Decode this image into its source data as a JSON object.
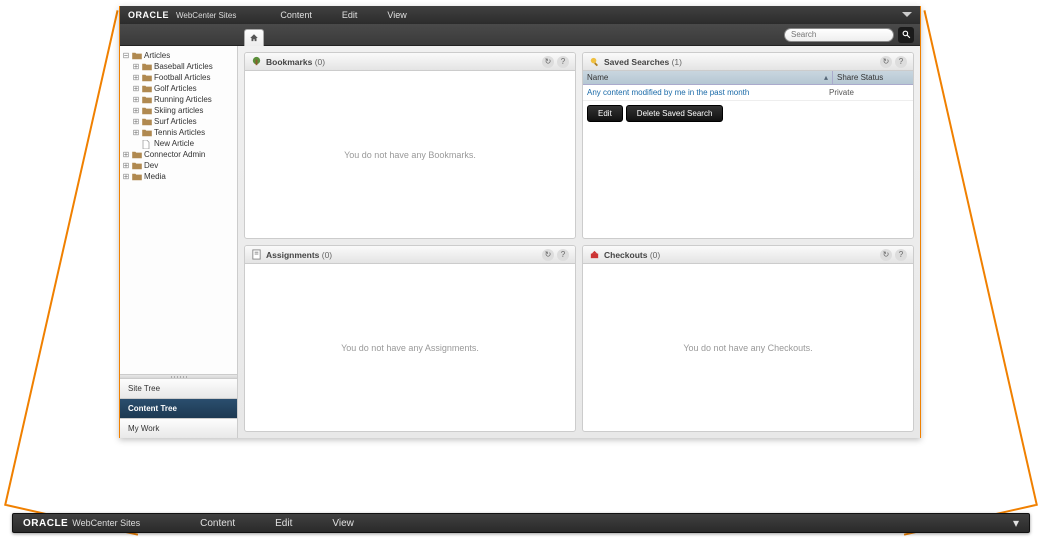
{
  "topbar": {
    "brand": "ORACLE",
    "subbrand": "WebCenter Sites",
    "menu": [
      "Content",
      "Edit",
      "View"
    ]
  },
  "search": {
    "placeholder": "Search"
  },
  "tree": [
    {
      "depth": 0,
      "exp": "-",
      "icon": "folder",
      "label": "Articles"
    },
    {
      "depth": 1,
      "exp": "+",
      "icon": "folder",
      "label": "Baseball Articles"
    },
    {
      "depth": 1,
      "exp": "+",
      "icon": "folder",
      "label": "Football Articles"
    },
    {
      "depth": 1,
      "exp": "+",
      "icon": "folder",
      "label": "Golf Articles"
    },
    {
      "depth": 1,
      "exp": "+",
      "icon": "folder",
      "label": "Running Articles"
    },
    {
      "depth": 1,
      "exp": "+",
      "icon": "folder",
      "label": "Skiing articles"
    },
    {
      "depth": 1,
      "exp": "+",
      "icon": "folder",
      "label": "Surf Articles"
    },
    {
      "depth": 1,
      "exp": "+",
      "icon": "folder",
      "label": "Tennis Articles"
    },
    {
      "depth": 1,
      "exp": "",
      "icon": "doc",
      "label": "New Article"
    },
    {
      "depth": 0,
      "exp": "+",
      "icon": "folder",
      "label": "Connector Admin"
    },
    {
      "depth": 0,
      "exp": "+",
      "icon": "folder",
      "label": "Dev"
    },
    {
      "depth": 0,
      "exp": "+",
      "icon": "folder",
      "label": "Media"
    }
  ],
  "side_tabs": {
    "site_tree": "Site Tree",
    "content_tree": "Content Tree",
    "my_work": "My Work",
    "active": "content_tree"
  },
  "panels": {
    "bookmarks": {
      "title": "Bookmarks",
      "count": "(0)",
      "empty": "You do not have any Bookmarks."
    },
    "saved_searches": {
      "title": "Saved Searches",
      "count": "(1)",
      "col_name": "Name",
      "col_status": "Share Status",
      "rows": [
        {
          "name": "Any content modified by me in the past month",
          "status": "Private"
        }
      ],
      "btn_edit": "Edit",
      "btn_delete": "Delete Saved Search"
    },
    "assignments": {
      "title": "Assignments",
      "count": "(0)",
      "empty": "You do not have any Assignments."
    },
    "checkouts": {
      "title": "Checkouts",
      "count": "(0)",
      "empty": "You do not have any Checkouts."
    }
  },
  "bottombar": {
    "brand": "ORACLE",
    "subbrand": "WebCenter Sites",
    "menu": [
      "Content",
      "Edit",
      "View"
    ]
  }
}
